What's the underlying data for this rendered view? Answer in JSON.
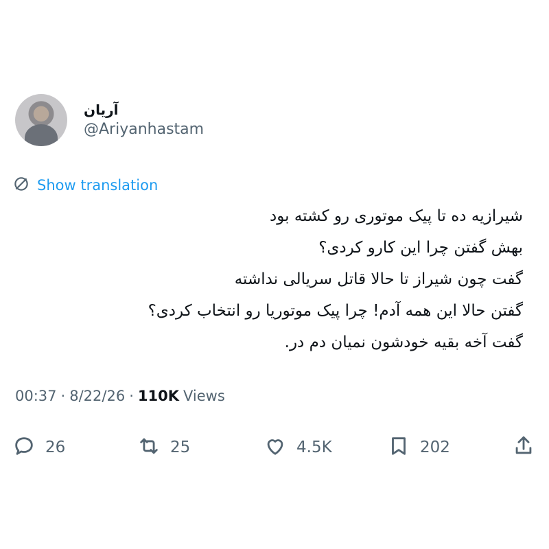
{
  "tweet": {
    "author": {
      "display_name": "آریان",
      "handle": "@Ariyanhastam"
    },
    "translation_link": "Show translation",
    "text_lines": [
      "شیرازیه ده تا پیک موتوری رو کشته بود",
      "بهش گفتن چرا این کارو کردی؟",
      "گفت چون شیراز تا حالا قاتل سریالی نداشته",
      "گفتن حالا این همه آدم! چرا پیک موتوریا رو انتخاب کردی؟",
      "گفت آخه بقیه خودشون نمیان دم در."
    ],
    "meta": {
      "time": "00:37",
      "separator": "·",
      "date": "8/22/26",
      "views_count": "110K",
      "views_label": "Views"
    },
    "actions": {
      "replies": "26",
      "retweets": "25",
      "likes": "4.5K",
      "bookmarks": "202"
    }
  },
  "colors": {
    "text": "#0f1419",
    "secondary": "#536471",
    "link": "#1d9bf0"
  },
  "icons": [
    "translate-icon",
    "reply-icon",
    "retweet-icon",
    "like-icon",
    "bookmark-icon",
    "share-icon"
  ]
}
